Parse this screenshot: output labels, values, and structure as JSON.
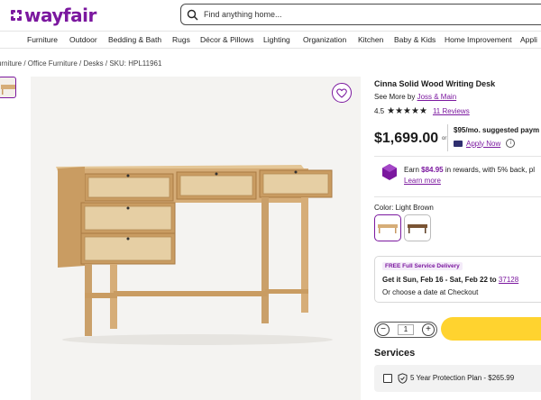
{
  "header": {
    "logo_text": "wayfair",
    "search_placeholder": "Find anything home..."
  },
  "nav": {
    "items": [
      "Furniture",
      "Outdoor",
      "Bedding & Bath",
      "Rugs",
      "Décor & Pillows",
      "Lighting",
      "Organization",
      "Kitchen",
      "Baby & Kids",
      "Home Improvement",
      "Appli"
    ]
  },
  "breadcrumb": {
    "path": "urniture / Office Furniture / Desks / SKU: HPL11961"
  },
  "product": {
    "title": "Cinna Solid Wood Writing Desk",
    "see_more_prefix": "See More by ",
    "brand": "Joss & Main",
    "rating_value": "4.5",
    "stars": "★★★★★",
    "reviews_label": "11 Reviews",
    "price": "$1,699.00",
    "or_label": "or",
    "monthly_payment": "$95/mo. suggested paym",
    "apply_now": "Apply Now",
    "info_glyph": "i",
    "rewards_prefix": "Earn ",
    "rewards_amount": "$84.95",
    "rewards_suffix": " in rewards, with 5% back",
    "rewards_tail": ", pl",
    "learn_more": "Learn more",
    "color_label": "Color: Light Brown",
    "colors": [
      "Light Brown",
      "Dark Brown"
    ]
  },
  "delivery": {
    "badge": "FREE Full Service Delivery",
    "get_it": "Get it Sun, Feb 16 - Sat, Feb 22 to ",
    "zip": "37128",
    "choose": "Or choose a date at Checkout"
  },
  "purchase": {
    "minus": "−",
    "qty": "1",
    "plus": "+"
  },
  "services": {
    "heading": "Services",
    "protection_plan": "5 Year Protection Plan - $265.99"
  },
  "colors": {
    "brand_purple": "#7b189f",
    "cart_yellow": "#ffd32f",
    "wood_light": "#d6ad78"
  }
}
